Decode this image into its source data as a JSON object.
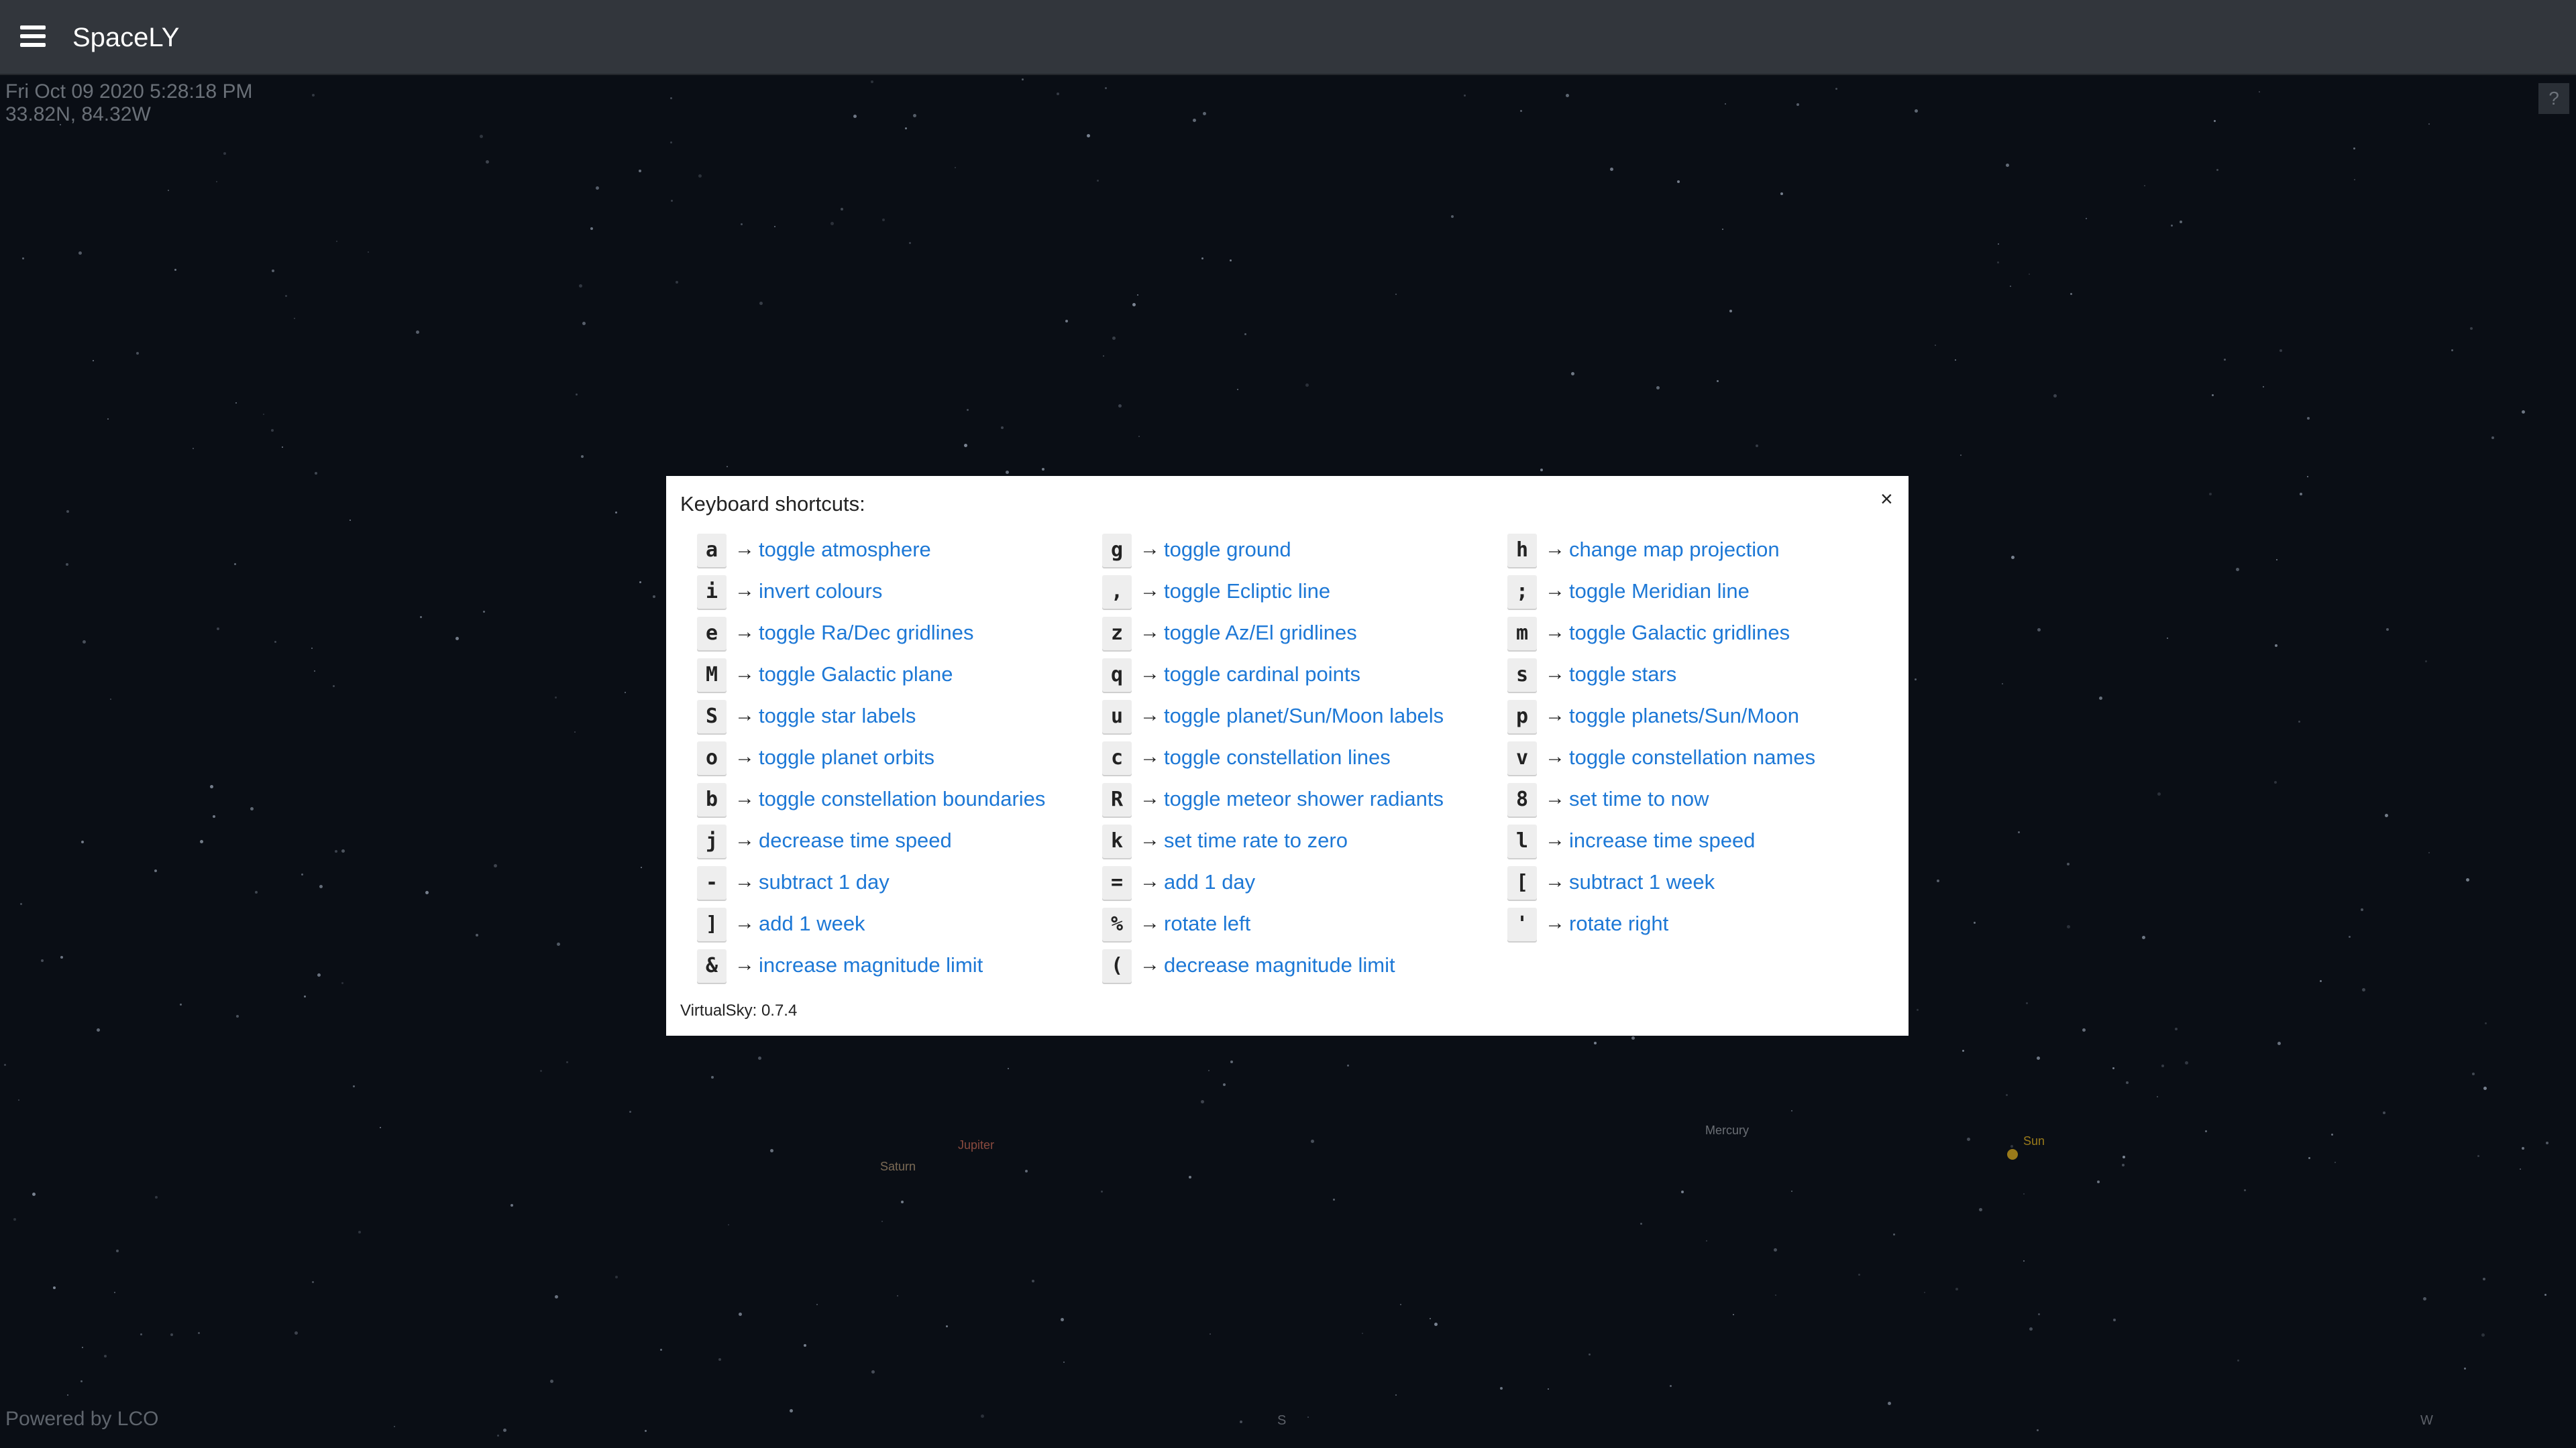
{
  "app": {
    "title": "SpaceLY"
  },
  "sky": {
    "datetime": "Fri Oct 09 2020 5:28:18 PM",
    "location": "33.82N, 84.32W",
    "help_label": "?",
    "powered_by": "Powered by LCO",
    "planets": [
      {
        "name": "Saturn",
        "color": "#7b6a55"
      },
      {
        "name": "Jupiter",
        "color": "#8a4a3e"
      },
      {
        "name": "Mercury",
        "color": "#6b6f75"
      },
      {
        "name": "Sun",
        "color": "#9a7a1a"
      }
    ],
    "compass": {
      "south": "S",
      "west": "W"
    }
  },
  "modal": {
    "title": "Keyboard shortcuts:",
    "close_label": "×",
    "version": "VirtualSky: 0.7.4",
    "arrow": "→",
    "columns": [
      [
        {
          "key": "a",
          "action": "toggle atmosphere"
        },
        {
          "key": "i",
          "action": "invert colours"
        },
        {
          "key": "e",
          "action": "toggle Ra/Dec gridlines"
        },
        {
          "key": "M",
          "action": "toggle Galactic plane"
        },
        {
          "key": "S",
          "action": "toggle star labels"
        },
        {
          "key": "o",
          "action": "toggle planet orbits"
        },
        {
          "key": "b",
          "action": "toggle constellation boundaries"
        },
        {
          "key": "j",
          "action": "decrease time speed"
        },
        {
          "key": "-",
          "action": "subtract 1 day"
        },
        {
          "key": "]",
          "action": "add 1 week"
        },
        {
          "key": "&",
          "action": "increase magnitude limit"
        }
      ],
      [
        {
          "key": "g",
          "action": "toggle ground"
        },
        {
          "key": ",",
          "action": "toggle Ecliptic line"
        },
        {
          "key": "z",
          "action": "toggle Az/El gridlines"
        },
        {
          "key": "q",
          "action": "toggle cardinal points"
        },
        {
          "key": "u",
          "action": "toggle planet/Sun/Moon labels"
        },
        {
          "key": "c",
          "action": "toggle constellation lines"
        },
        {
          "key": "R",
          "action": "toggle meteor shower radiants"
        },
        {
          "key": "k",
          "action": "set time rate to zero"
        },
        {
          "key": "=",
          "action": "add 1 day"
        },
        {
          "key": "%",
          "action": "rotate left"
        },
        {
          "key": "(",
          "action": "decrease magnitude limit"
        }
      ],
      [
        {
          "key": "h",
          "action": "change map projection"
        },
        {
          "key": ";",
          "action": "toggle Meridian line"
        },
        {
          "key": "m",
          "action": "toggle Galactic gridlines"
        },
        {
          "key": "s",
          "action": "toggle stars"
        },
        {
          "key": "p",
          "action": "toggle planets/Sun/Moon"
        },
        {
          "key": "v",
          "action": "toggle constellation names"
        },
        {
          "key": "8",
          "action": "set time to now"
        },
        {
          "key": "l",
          "action": "increase time speed"
        },
        {
          "key": "[",
          "action": "subtract 1 week"
        },
        {
          "key": "'",
          "action": "rotate right"
        }
      ]
    ]
  }
}
